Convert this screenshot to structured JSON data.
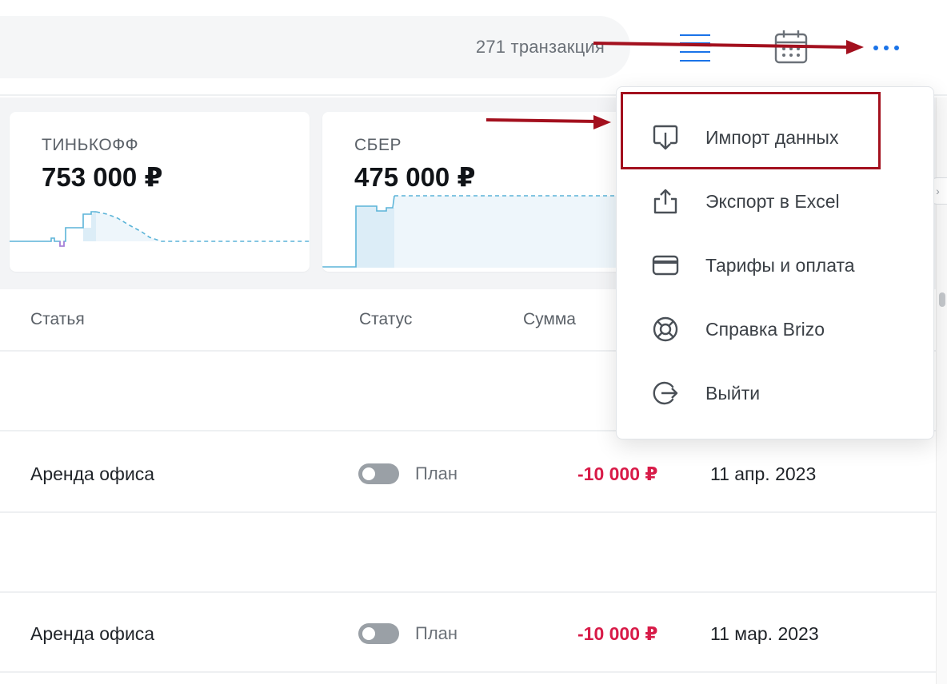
{
  "header": {
    "transaction_count": "271 транзакция",
    "icons": [
      "list-icon",
      "calendar-icon",
      "more-icon"
    ]
  },
  "accounts": [
    {
      "name": "ТИНЬКОФФ",
      "balance": "753 000 ₽"
    },
    {
      "name": "СБЕР",
      "balance": "475 000 ₽"
    }
  ],
  "table": {
    "columns": [
      "Статья",
      "Статус",
      "Сумма"
    ],
    "rows": [
      {
        "name": "Аренда офиса",
        "status": "План",
        "amount": "-10 000 ₽",
        "date": "11 апр. 2023"
      },
      {
        "name": "Аренда офиса",
        "status": "План",
        "amount": "-10 000 ₽",
        "date": "11 мар. 2023"
      }
    ]
  },
  "menu": {
    "items": [
      {
        "label": "Импорт данных",
        "icon": "import-icon"
      },
      {
        "label": "Экспорт в Excel",
        "icon": "export-icon"
      },
      {
        "label": "Тарифы и оплата",
        "icon": "credit-card-icon"
      },
      {
        "label": "Справка Brizo",
        "icon": "help-lifebuoy-icon"
      },
      {
        "label": "Выйти",
        "icon": "logout-icon"
      }
    ]
  },
  "colors": {
    "accent_blue": "#1a73e8",
    "negative_amount": "#d81b48",
    "annotation_red": "#a3101e",
    "chart_line": "#5bb4d8"
  }
}
